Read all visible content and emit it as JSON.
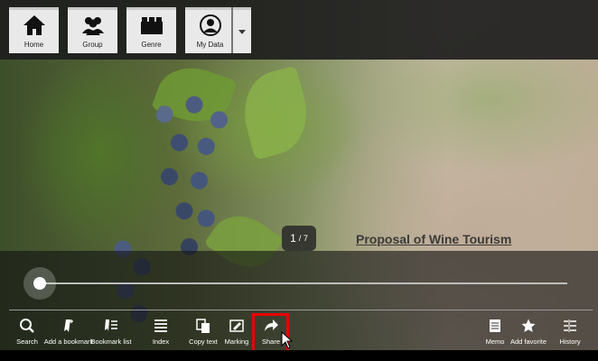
{
  "nav": {
    "home": {
      "label": "Home",
      "icon": "home-icon"
    },
    "group": {
      "label": "Group",
      "icon": "group-icon"
    },
    "genre": {
      "label": "Genre",
      "icon": "genre-icon"
    },
    "mydata": {
      "label": "My Data",
      "icon": "user-icon"
    },
    "more": {
      "icon": "triangle-down-icon"
    }
  },
  "slide": {
    "page_current": "1",
    "page_total": "/ 7",
    "title": "Proposal of Wine Tourism"
  },
  "slider": {
    "position": 0.0
  },
  "toolbar": [
    {
      "label": "Search",
      "icon": "search-icon"
    },
    {
      "label": "Add a bookmark",
      "icon": "bookmark-add-icon"
    },
    {
      "label": "Bookmark list",
      "icon": "bookmark-list-icon"
    },
    {
      "label": "Index",
      "icon": "index-icon"
    },
    {
      "label": "Copy text",
      "icon": "copy-text-icon"
    },
    {
      "label": "Marking",
      "icon": "marking-icon"
    },
    {
      "label": "Share",
      "icon": "share-icon"
    },
    {
      "label": "Memo",
      "icon": "memo-icon"
    },
    {
      "label": "Add favorite",
      "icon": "star-icon"
    },
    {
      "label": "History",
      "icon": "history-icon"
    }
  ],
  "colors": {
    "highlight": "#e60000",
    "nav_bg": "#e9e9e9",
    "toolbar_text": "#ffffff"
  }
}
